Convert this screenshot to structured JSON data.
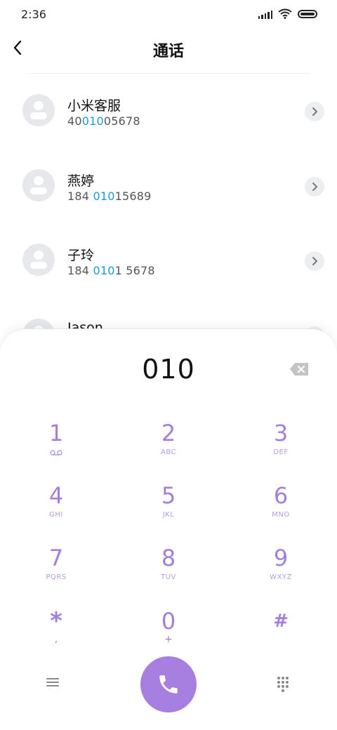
{
  "status_bar": {
    "time": "2:36",
    "icons": [
      "signal-icon",
      "wifi-icon",
      "battery-icon"
    ]
  },
  "header": {
    "title": "通话",
    "back_icon": "chevron-left-icon"
  },
  "contacts": [
    {
      "name": "小米客服",
      "number_pre": "40",
      "number_match": "010",
      "number_post": "05678"
    },
    {
      "name": "燕婷",
      "number_pre": "184 ",
      "number_match": "010",
      "number_post": "15689"
    },
    {
      "name": "子玲",
      "number_pre": "184 ",
      "number_match": "010",
      "number_post": "1 5678"
    },
    {
      "name": "Jason",
      "number_pre": "",
      "number_match": "",
      "number_post": ""
    }
  ],
  "dialer": {
    "input": "010",
    "keys": [
      {
        "digit": "1",
        "letters": ""
      },
      {
        "digit": "2",
        "letters": "ABC"
      },
      {
        "digit": "3",
        "letters": "DEF"
      },
      {
        "digit": "4",
        "letters": "GHI"
      },
      {
        "digit": "5",
        "letters": "JKL"
      },
      {
        "digit": "6",
        "letters": "MNO"
      },
      {
        "digit": "7",
        "letters": "PQRS"
      },
      {
        "digit": "8",
        "letters": "TUV"
      },
      {
        "digit": "9",
        "letters": "WXYZ"
      },
      {
        "digit": "*",
        "letters": ","
      },
      {
        "digit": "0",
        "letters": "+"
      },
      {
        "digit": "#",
        "letters": ""
      }
    ]
  },
  "colors": {
    "accent": "#a77fe0",
    "match_highlight": "#1a9bd6"
  }
}
